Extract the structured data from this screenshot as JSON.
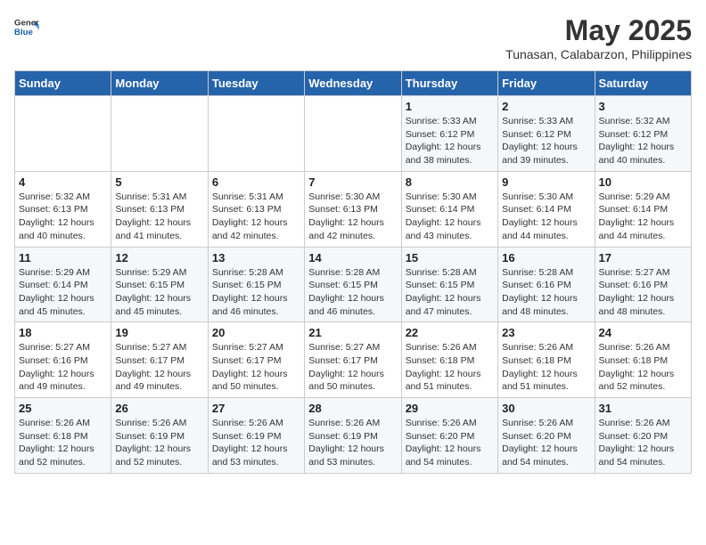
{
  "logo": {
    "general": "General",
    "blue": "Blue"
  },
  "header": {
    "title": "May 2025",
    "subtitle": "Tunasan, Calabarzon, Philippines"
  },
  "weekdays": [
    "Sunday",
    "Monday",
    "Tuesday",
    "Wednesday",
    "Thursday",
    "Friday",
    "Saturday"
  ],
  "weeks": [
    [
      {
        "day": "",
        "detail": ""
      },
      {
        "day": "",
        "detail": ""
      },
      {
        "day": "",
        "detail": ""
      },
      {
        "day": "",
        "detail": ""
      },
      {
        "day": "1",
        "detail": "Sunrise: 5:33 AM\nSunset: 6:12 PM\nDaylight: 12 hours\nand 38 minutes."
      },
      {
        "day": "2",
        "detail": "Sunrise: 5:33 AM\nSunset: 6:12 PM\nDaylight: 12 hours\nand 39 minutes."
      },
      {
        "day": "3",
        "detail": "Sunrise: 5:32 AM\nSunset: 6:12 PM\nDaylight: 12 hours\nand 40 minutes."
      }
    ],
    [
      {
        "day": "4",
        "detail": "Sunrise: 5:32 AM\nSunset: 6:13 PM\nDaylight: 12 hours\nand 40 minutes."
      },
      {
        "day": "5",
        "detail": "Sunrise: 5:31 AM\nSunset: 6:13 PM\nDaylight: 12 hours\nand 41 minutes."
      },
      {
        "day": "6",
        "detail": "Sunrise: 5:31 AM\nSunset: 6:13 PM\nDaylight: 12 hours\nand 42 minutes."
      },
      {
        "day": "7",
        "detail": "Sunrise: 5:30 AM\nSunset: 6:13 PM\nDaylight: 12 hours\nand 42 minutes."
      },
      {
        "day": "8",
        "detail": "Sunrise: 5:30 AM\nSunset: 6:14 PM\nDaylight: 12 hours\nand 43 minutes."
      },
      {
        "day": "9",
        "detail": "Sunrise: 5:30 AM\nSunset: 6:14 PM\nDaylight: 12 hours\nand 44 minutes."
      },
      {
        "day": "10",
        "detail": "Sunrise: 5:29 AM\nSunset: 6:14 PM\nDaylight: 12 hours\nand 44 minutes."
      }
    ],
    [
      {
        "day": "11",
        "detail": "Sunrise: 5:29 AM\nSunset: 6:14 PM\nDaylight: 12 hours\nand 45 minutes."
      },
      {
        "day": "12",
        "detail": "Sunrise: 5:29 AM\nSunset: 6:15 PM\nDaylight: 12 hours\nand 45 minutes."
      },
      {
        "day": "13",
        "detail": "Sunrise: 5:28 AM\nSunset: 6:15 PM\nDaylight: 12 hours\nand 46 minutes."
      },
      {
        "day": "14",
        "detail": "Sunrise: 5:28 AM\nSunset: 6:15 PM\nDaylight: 12 hours\nand 46 minutes."
      },
      {
        "day": "15",
        "detail": "Sunrise: 5:28 AM\nSunset: 6:15 PM\nDaylight: 12 hours\nand 47 minutes."
      },
      {
        "day": "16",
        "detail": "Sunrise: 5:28 AM\nSunset: 6:16 PM\nDaylight: 12 hours\nand 48 minutes."
      },
      {
        "day": "17",
        "detail": "Sunrise: 5:27 AM\nSunset: 6:16 PM\nDaylight: 12 hours\nand 48 minutes."
      }
    ],
    [
      {
        "day": "18",
        "detail": "Sunrise: 5:27 AM\nSunset: 6:16 PM\nDaylight: 12 hours\nand 49 minutes."
      },
      {
        "day": "19",
        "detail": "Sunrise: 5:27 AM\nSunset: 6:17 PM\nDaylight: 12 hours\nand 49 minutes."
      },
      {
        "day": "20",
        "detail": "Sunrise: 5:27 AM\nSunset: 6:17 PM\nDaylight: 12 hours\nand 50 minutes."
      },
      {
        "day": "21",
        "detail": "Sunrise: 5:27 AM\nSunset: 6:17 PM\nDaylight: 12 hours\nand 50 minutes."
      },
      {
        "day": "22",
        "detail": "Sunrise: 5:26 AM\nSunset: 6:18 PM\nDaylight: 12 hours\nand 51 minutes."
      },
      {
        "day": "23",
        "detail": "Sunrise: 5:26 AM\nSunset: 6:18 PM\nDaylight: 12 hours\nand 51 minutes."
      },
      {
        "day": "24",
        "detail": "Sunrise: 5:26 AM\nSunset: 6:18 PM\nDaylight: 12 hours\nand 52 minutes."
      }
    ],
    [
      {
        "day": "25",
        "detail": "Sunrise: 5:26 AM\nSunset: 6:18 PM\nDaylight: 12 hours\nand 52 minutes."
      },
      {
        "day": "26",
        "detail": "Sunrise: 5:26 AM\nSunset: 6:19 PM\nDaylight: 12 hours\nand 52 minutes."
      },
      {
        "day": "27",
        "detail": "Sunrise: 5:26 AM\nSunset: 6:19 PM\nDaylight: 12 hours\nand 53 minutes."
      },
      {
        "day": "28",
        "detail": "Sunrise: 5:26 AM\nSunset: 6:19 PM\nDaylight: 12 hours\nand 53 minutes."
      },
      {
        "day": "29",
        "detail": "Sunrise: 5:26 AM\nSunset: 6:20 PM\nDaylight: 12 hours\nand 54 minutes."
      },
      {
        "day": "30",
        "detail": "Sunrise: 5:26 AM\nSunset: 6:20 PM\nDaylight: 12 hours\nand 54 minutes."
      },
      {
        "day": "31",
        "detail": "Sunrise: 5:26 AM\nSunset: 6:20 PM\nDaylight: 12 hours\nand 54 minutes."
      }
    ]
  ]
}
